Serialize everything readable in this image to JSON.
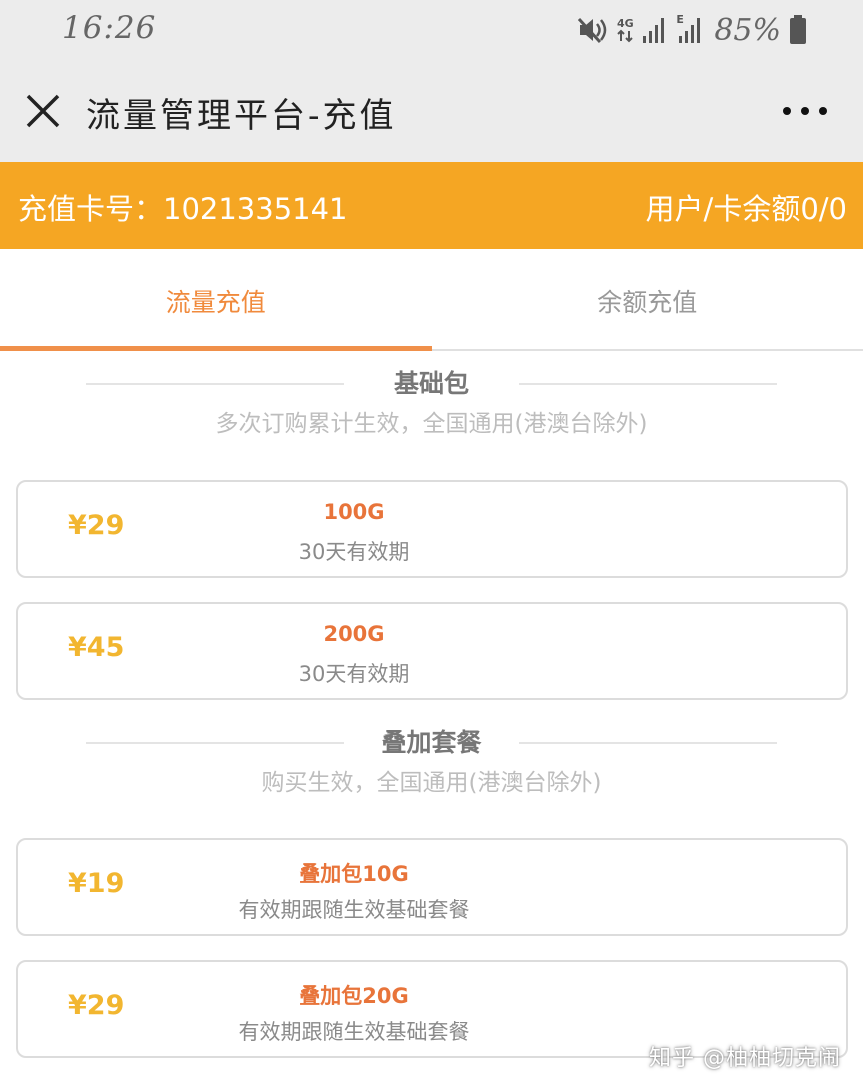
{
  "status_bar": {
    "time": "16:26",
    "network_4g": "4G",
    "network_e": "E",
    "battery_pct": "85%",
    "icons": [
      "mute-icon",
      "network-4g-icon",
      "signal-icon",
      "network-e-icon",
      "signal-icon",
      "battery-icon"
    ]
  },
  "title_bar": {
    "title": "流量管理平台-充值",
    "close_icon": "close-icon",
    "more_icon": "more-dots-icon"
  },
  "header": {
    "card_number": "充值卡号：1021335141",
    "balance": "用户/卡余额0/0",
    "color": "#f5a623"
  },
  "tabs": [
    {
      "label": "流量充值",
      "active": true
    },
    {
      "label": "余额充值",
      "active": false
    }
  ],
  "sections": [
    {
      "title": "基础包",
      "subtitle": "多次订购累计生效，全国通用(港澳台除外)",
      "packages": [
        {
          "price": "¥29",
          "name": "100G",
          "desc": "30天有效期"
        },
        {
          "price": "¥45",
          "name": "200G",
          "desc": "30天有效期"
        }
      ]
    },
    {
      "title": "叠加套餐",
      "subtitle": "购买生效，全国通用(港澳台除外)",
      "packages": [
        {
          "price": "¥19",
          "name": "叠加包10G",
          "desc": "有效期跟随生效基础套餐"
        },
        {
          "price": "¥29",
          "name": "叠加包20G",
          "desc": "有效期跟随生效基础套餐"
        }
      ]
    }
  ],
  "watermark": "知乎 @柚柚切克闹",
  "colors": {
    "accent": "#f5a623",
    "price": "#f2b630",
    "package_name": "#e8743a",
    "tab_active": "#f08a3c"
  }
}
